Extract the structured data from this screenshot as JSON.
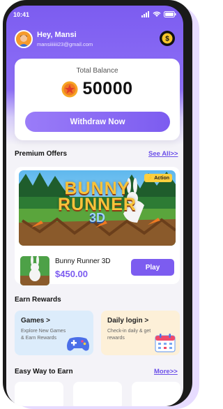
{
  "status": {
    "time": "10:41"
  },
  "header": {
    "greeting": "Hey, Mansi",
    "email": "mansiiiiiii23@gmail.com"
  },
  "balance": {
    "label": "Total Balance",
    "value": "50000",
    "withdraw_label": "Withdraw Now"
  },
  "premium": {
    "title": "Premium Offers",
    "see_all": "See All>>",
    "tag": "Action",
    "banner_title_line1": "BUNNY",
    "banner_title_line2": "RUNNER",
    "banner_title_line3": "3D",
    "game_name": "Bunny Runner 3D",
    "price": "$450.00",
    "play_label": "Play"
  },
  "earn": {
    "title": "Earn Rewards",
    "tiles": [
      {
        "title": "Games >",
        "desc_line1": "Explore New Games",
        "desc_line2": "& Earn Rewards"
      },
      {
        "title": "Daily login >",
        "desc_line1": "Check-in daily & get",
        "desc_line2": "rewards"
      }
    ]
  },
  "easy": {
    "title": "Easy Way to Earn",
    "more": "More>>"
  },
  "colors": {
    "accent": "#7c5cf0",
    "coin": "#f5a623",
    "tile_games": "#dcecfb",
    "tile_daily": "#fdf0d8"
  }
}
